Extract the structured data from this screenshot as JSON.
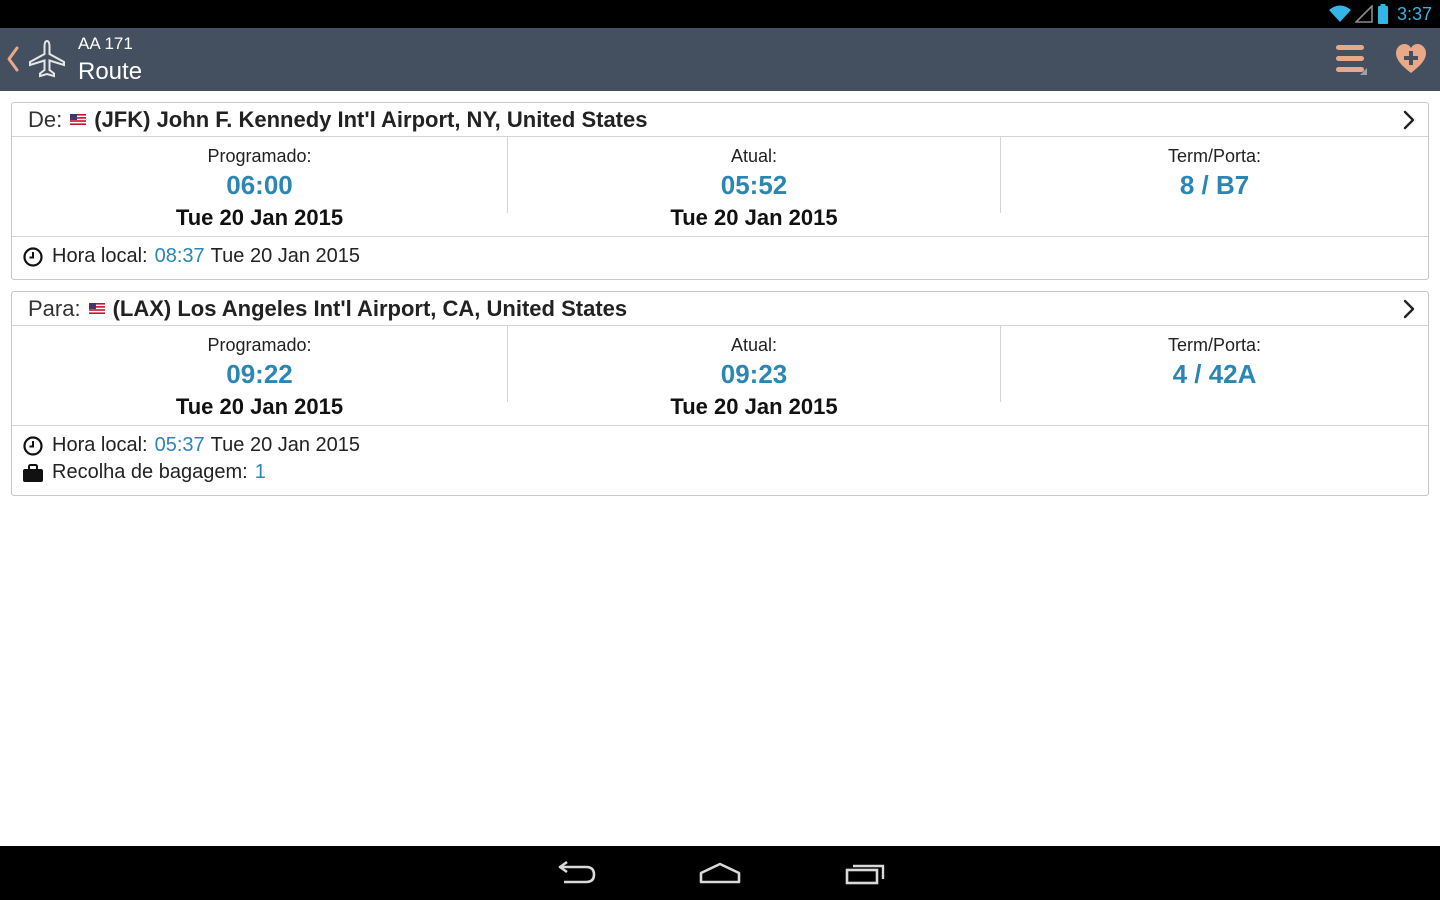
{
  "status_bar": {
    "time": "3:37",
    "icons": [
      "wifi-icon",
      "signal-icon",
      "battery-icon"
    ]
  },
  "action_bar": {
    "flight_code": "AA 171",
    "title": "Route",
    "icons": [
      "back-chevron-icon",
      "airplane-icon",
      "menu-icon",
      "favorite-add-icon"
    ]
  },
  "departure": {
    "prefix": "De:",
    "airport": "(JFK) John F. Kennedy Int'l Airport, NY, United States",
    "scheduled_label": "Programado:",
    "scheduled_time": "06:00",
    "scheduled_date": "Tue 20 Jan 2015",
    "actual_label": "Atual:",
    "actual_time": "05:52",
    "actual_date": "Tue 20 Jan 2015",
    "gate_label": "Term/Porta:",
    "gate_value": "8 / B7",
    "local_label": "Hora local:",
    "local_time": "08:37",
    "local_date": "Tue 20 Jan 2015"
  },
  "arrival": {
    "prefix": "Para:",
    "airport": "(LAX) Los Angeles Int'l Airport, CA, United States",
    "scheduled_label": "Programado:",
    "scheduled_time": "09:22",
    "scheduled_date": "Tue 20 Jan 2015",
    "actual_label": "Atual:",
    "actual_time": "09:23",
    "actual_date": "Tue 20 Jan 2015",
    "gate_label": "Term/Porta:",
    "gate_value": "4 / 42A",
    "local_label": "Hora local:",
    "local_time": "05:37",
    "local_date": "Tue 20 Jan 2015",
    "baggage_label": "Recolha de bagagem:",
    "baggage_value": "1"
  },
  "colors": {
    "accent": "#2a86b3",
    "action_bar": "#44505f",
    "icon_peach": "#e8a98a"
  }
}
